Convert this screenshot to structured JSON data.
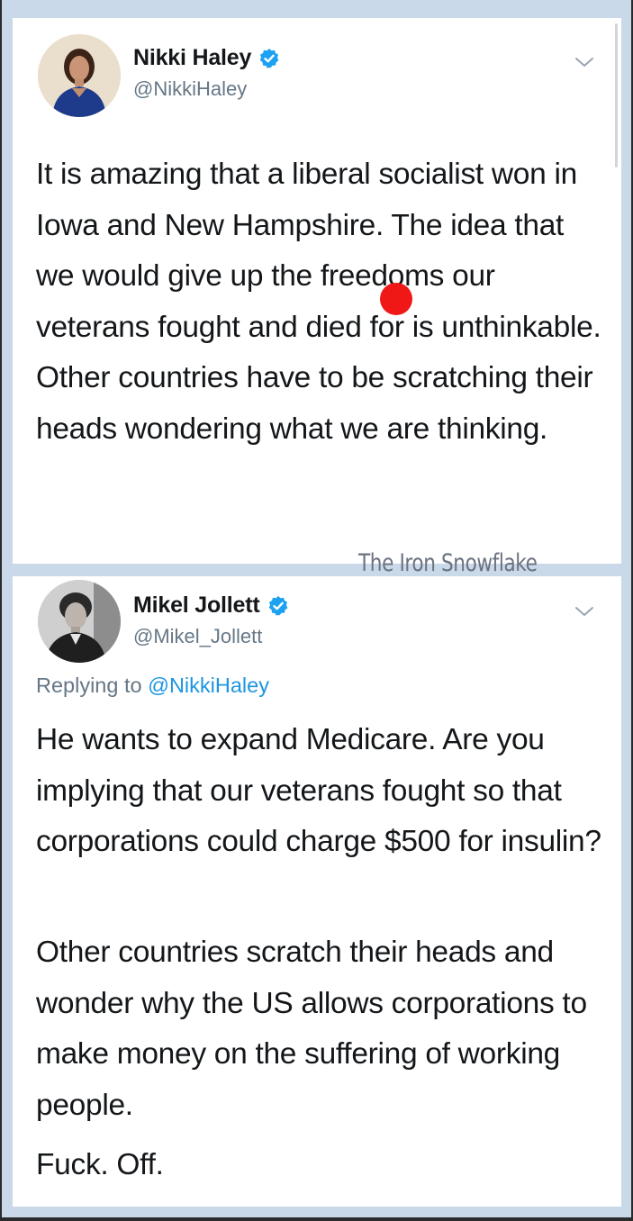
{
  "tweet1": {
    "name": "Nikki Haley",
    "handle": "@NikkiHaley",
    "text": "It is amazing that a liberal socialist won in Iowa and New Hampshire. The idea that we would give up the freedoms our veterans fought and died for is unthinkable. Other countries have to be scratching their heads wondering what we are thinking.",
    "verified_icon": "verified-badge-icon",
    "menu_icon": "chevron-down-icon"
  },
  "tweet2": {
    "name": "Mikel Jollett",
    "handle": "@Mikel_Jollett",
    "replying_prefix": "Replying to ",
    "replying_mention": "@NikkiHaley",
    "paragraphs": [
      "He wants to expand Medicare. Are you implying that our veterans fought so that corporations could charge $500 for insulin?",
      "Other countries scratch their heads and wonder why the US allows corporations to make money on the suffering of working people.",
      "Fuck. Off."
    ],
    "verified_icon": "verified-badge-icon",
    "menu_icon": "chevron-down-icon"
  },
  "watermark": "The Iron Snowflake",
  "colors": {
    "verified": "#1da1f2",
    "link": "#1b95e0",
    "secondary_text": "#657786",
    "primary_text": "#14171a",
    "background_frame": "#c9d9ea",
    "marker_dot": "#f01717"
  }
}
